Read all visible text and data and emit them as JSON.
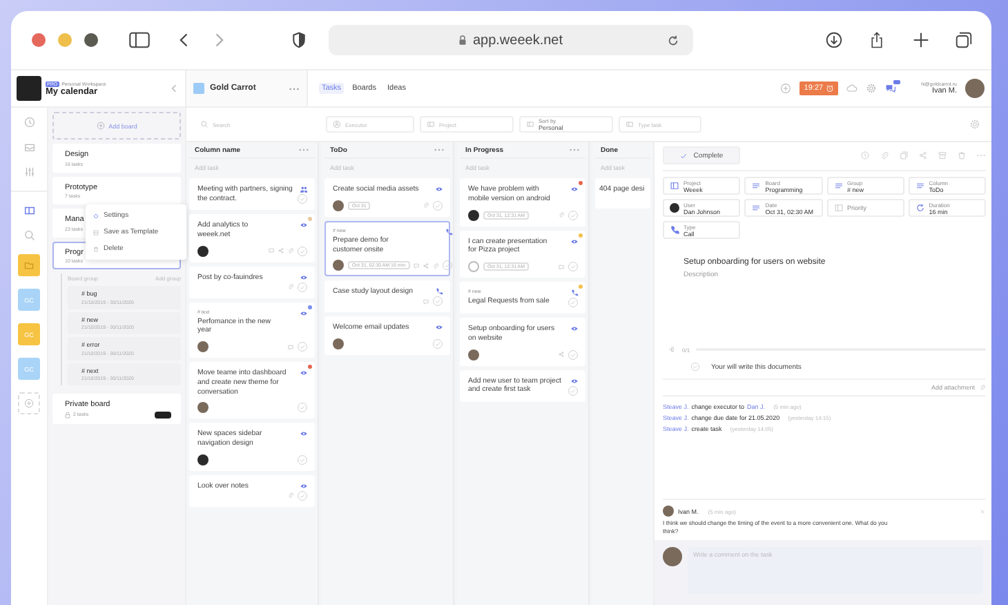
{
  "browser": {
    "url": "app.weeek.net"
  },
  "workspace": {
    "badge": "PRO",
    "label": "Personal Workspace",
    "title": "My calendar"
  },
  "board": {
    "title": "Gold Carrot"
  },
  "tabs": [
    {
      "label": "Tasks",
      "selected": true
    },
    {
      "label": "Boards",
      "selected": false
    },
    {
      "label": "Ideas",
      "selected": false
    }
  ],
  "header": {
    "timer": "19:27",
    "email": "hi@goldcarrot.ru",
    "user": "Ivan M."
  },
  "rail": {
    "projects": [
      {
        "kind": "icon",
        "color": "#f6c343"
      },
      {
        "kind": "text",
        "label": "GC",
        "color": "#a9d4f7"
      },
      {
        "kind": "text",
        "label": "GC",
        "color": "#f6c343"
      },
      {
        "kind": "text",
        "label": "GC",
        "color": "#a9d4f7"
      }
    ]
  },
  "boards_panel": {
    "add_board": "Add board",
    "boards": [
      {
        "title": "Design",
        "count": "16 tasks",
        "selected": false
      },
      {
        "title": "Prototype",
        "count": "7 tasks",
        "selected": false
      },
      {
        "title": "Mana",
        "count": "23 tasks",
        "selected": false
      },
      {
        "title": "Progr",
        "count": "10 tasks",
        "selected": true,
        "group_header": "Board group",
        "add_group": "Add group",
        "children": [
          {
            "title": "# bug",
            "dates": "21/10/2019 - 30/11/2020"
          },
          {
            "title": "# new",
            "dates": "21/10/2019 - 30/11/2020"
          },
          {
            "title": "# error",
            "dates": "21/10/2019 - 30/11/2020"
          },
          {
            "title": "# next",
            "dates": "21/10/2019 - 30/11/2020"
          }
        ]
      }
    ],
    "private": {
      "title": "Private board",
      "count": "2 tasks"
    }
  },
  "context_menu": [
    {
      "kind": "settings",
      "label": "Settings"
    },
    {
      "kind": "template",
      "label": "Save as Template"
    },
    {
      "kind": "delete",
      "label": "Delete"
    }
  ],
  "filters": [
    {
      "kind": "search",
      "placeholder": "Search"
    },
    {
      "kind": "executor",
      "placeholder": "Executor"
    },
    {
      "kind": "project",
      "placeholder": "Project"
    },
    {
      "kind": "sort",
      "label": "Sort by",
      "value": "Personal"
    },
    {
      "kind": "type",
      "placeholder": "Type task"
    }
  ],
  "columns": [
    {
      "name": "Column name",
      "add": "Add task",
      "cards": [
        {
          "title": "Meeting with partners, signing the contract.",
          "type": {
            "kind": "people"
          },
          "selected": false
        },
        {
          "title": "Add analytics to weeek.net",
          "avatar": {
            "kind": "dark"
          },
          "color": "#e8c9a0",
          "type": {
            "kind": "eye"
          },
          "icons": [
            {
              "kind": "comment"
            },
            {
              "kind": "share"
            },
            {
              "kind": "paperclip"
            }
          ],
          "selected": false
        },
        {
          "title": "Post by co-fauindres",
          "type": {
            "kind": "eye"
          },
          "icons": [
            {
              "kind": "paperclip"
            }
          ],
          "selected": false
        },
        {
          "tag": "# text",
          "title": "Perfomance in the new year",
          "avatar": {
            "kind": "photo"
          },
          "color": "#7b8ef0",
          "type": {
            "kind": "eye"
          },
          "icons": [
            {
              "kind": "comment"
            }
          ],
          "selected": false
        },
        {
          "title": "Move teame into dashboard and create new theme for conversation",
          "avatar": {
            "kind": "photo"
          },
          "color": "#e5674f",
          "type": {
            "kind": "eye"
          },
          "selected": false
        },
        {
          "title": "New spaces sidebar navigation design",
          "avatar": {
            "kind": "dark"
          },
          "type": {
            "kind": "eye"
          },
          "selected": false
        },
        {
          "title": "Look over notes",
          "type": {
            "kind": "eye"
          },
          "icons": [
            {
              "kind": "paperclip"
            }
          ],
          "selected": false
        }
      ]
    },
    {
      "name": "ToDo",
      "add": "Add task",
      "cards": [
        {
          "title": "Create social media assets",
          "avatar": {
            "kind": "photo"
          },
          "date": "Oct 31",
          "type": {
            "kind": "eye"
          },
          "icons": [
            {
              "kind": "paperclip"
            }
          ],
          "selected": false
        },
        {
          "tag": "# new",
          "title": "Prepare demo for customer onsite",
          "avatar": {
            "kind": "photo"
          },
          "date": "Oct 31, 02:30 AM 16 min",
          "type": {
            "kind": "phone"
          },
          "icons": [
            {
              "kind": "comment"
            },
            {
              "kind": "share"
            },
            {
              "kind": "paperclip"
            }
          ],
          "selected": true
        },
        {
          "title": "Case study layout design",
          "type": {
            "kind": "phone"
          },
          "icons": [
            {
              "kind": "comment"
            }
          ],
          "selected": false
        },
        {
          "title": "Welcome email updates",
          "avatar": {
            "kind": "photo"
          },
          "type": {
            "kind": "eye"
          },
          "selected": false
        }
      ]
    },
    {
      "name": "In Progress",
      "add": "Add task",
      "cards": [
        {
          "title": "We have problem with mobile version on android",
          "avatar": {
            "kind": "dark"
          },
          "color": "#e5674f",
          "date": "Oct 31, 12:31 AM",
          "type": {
            "kind": "eye"
          },
          "icons": [
            {
              "kind": "paperclip"
            }
          ],
          "selected": false
        },
        {
          "title": "I can create presentation for Pizza project",
          "avatar": {
            "kind": "empty"
          },
          "color": "#f2c04e",
          "date": "Oct 31, 12:31 AM",
          "type": {
            "kind": "eye"
          },
          "icons": [
            {
              "kind": "comment"
            }
          ],
          "selected": false
        },
        {
          "tag": "# new",
          "title": "Legal Requests from sale",
          "color": "#f2c04e",
          "type": {
            "kind": "phone"
          },
          "selected": false
        },
        {
          "title": "Setup onboarding for users on website",
          "avatar": {
            "kind": "photo"
          },
          "type": {
            "kind": "eye"
          },
          "icons": [
            {
              "kind": "share"
            }
          ],
          "selected": false
        },
        {
          "title": "Add new user to team project and create first task",
          "type": {
            "kind": "eye"
          },
          "selected": false
        }
      ]
    },
    {
      "name": "Done",
      "add": "Add task",
      "cards": [
        {
          "title": "404 page desi",
          "selected": false
        }
      ]
    }
  ],
  "detail": {
    "complete": "Complete",
    "fields": [
      {
        "kind": "project",
        "label": "Project",
        "value": "Weeek"
      },
      {
        "kind": "list",
        "label": "Board",
        "value": "Programming"
      },
      {
        "kind": "list",
        "label": "Group",
        "value": "# new"
      },
      {
        "kind": "list",
        "label": "Column",
        "value": "ToDo"
      },
      {
        "kind": "user",
        "label": "User",
        "value": "Dan Johnson"
      },
      {
        "kind": "list",
        "label": "Date",
        "value": "Oct 31, 02:30 AM"
      },
      {
        "kind": "priority",
        "label": "Priority"
      },
      {
        "kind": "duration",
        "label": "Duration",
        "value": "16 min"
      },
      {
        "kind": "type",
        "label": "Type",
        "value": "Call"
      }
    ],
    "title": "Setup onboarding for users on website",
    "description": "Description",
    "checklist": {
      "count": "0/1",
      "level": 0,
      "items": [
        {
          "text": "Your will write this documents",
          "checked": false
        }
      ]
    },
    "add_attachment": "Add attachment",
    "activity": [
      {
        "actor": "Steave J.",
        "action": "change executor to",
        "target": "Dan J.",
        "time": "(5 min ago)"
      },
      {
        "actor": "Steave J.",
        "action": "change due date for 21.05.2020",
        "time": "(yesterday 14:15)"
      },
      {
        "actor": "Steave J.",
        "action": "create task",
        "time": "(yesterday 14:05)"
      }
    ],
    "comment": {
      "author": "Ivan M.",
      "time": "(5 min ago)",
      "text": "I think we should change the timing of the event to a more convenient one. What do you think?"
    },
    "comment_field": {
      "placeholder": "Write a comment on the task"
    }
  }
}
